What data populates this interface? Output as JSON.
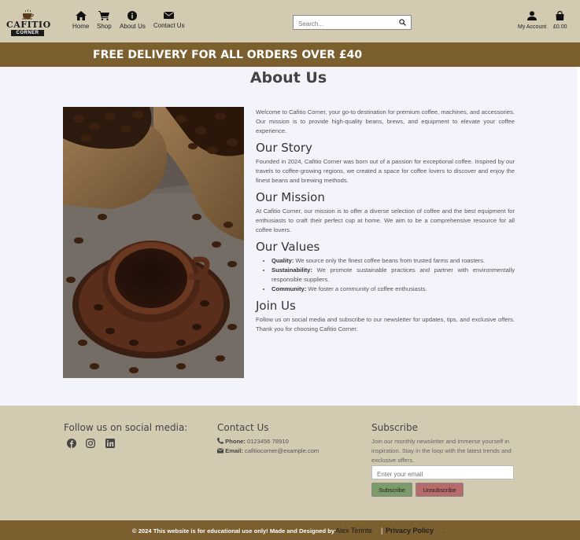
{
  "header": {
    "logo_text": "CAFITIO",
    "logo_sub": "CORNER",
    "nav": [
      {
        "label": "Home",
        "icon": "home-icon"
      },
      {
        "label": "Shop",
        "icon": "cart-icon"
      },
      {
        "label": "About Us",
        "icon": "info-icon"
      },
      {
        "label": "Contact Us",
        "icon": "envelope-icon"
      }
    ],
    "search_placeholder": "Search...",
    "account_label": "My Account",
    "cart_total": "£0.00"
  },
  "banner": {
    "text": "FREE DELIVERY FOR ALL ORDERS OVER £40"
  },
  "main": {
    "title": "About Us",
    "intro": "Welcome to Cafitio Corner, your go-to destination for premium coffee, machines, and accessories. Our mission is to provide high-quality beans, brews, and equipment to elevate your coffee experience.",
    "story_title": "Our Story",
    "story": "Founded in 2024, Cafitio Corner was born out of a passion for exceptional coffee. Inspired by our travels to coffee-growing regions, we created a space for coffee lovers to discover and enjoy the finest beans and brewing methods.",
    "mission_title": "Our Mission",
    "mission": "At Cafitio Corner, our mission is to offer a diverse selection of coffee and the best equipment for enthusiasts to craft their perfect cup at home. We aim to be a comprehensive resource for all coffee lovers.",
    "values_title": "Our Values",
    "values": [
      {
        "term": "Quality:",
        "text": " We source only the finest coffee beans from trusted farms and roasters."
      },
      {
        "term": "Sustainability:",
        "text": " We promote sustainable practices and partner with environmentally responsible suppliers."
      },
      {
        "term": "Community:",
        "text": " We foster a community of coffee enthusiasts."
      }
    ],
    "join_title": "Join Us",
    "join": "Follow us on social media and subscribe to our newsletter for updates, tips, and exclusive offers. Thank you for choosing Cafitio Corner."
  },
  "footer": {
    "social_title": "Follow us on social media:",
    "social_icons": [
      "facebook-icon",
      "instagram-icon",
      "linkedin-icon"
    ],
    "contact_title": "Contact Us",
    "phone_label": "Phone:",
    "phone": " 0123456 78910",
    "email_label": "Email:",
    "email": " cafitiocorner@example.com",
    "subscribe_title": "Subscribe",
    "subscribe_desc": "Join our monthly newsletter and immerse yourself in inspiration. Stay in the loop with the latest trends and exclusive offers.",
    "email_placeholder": "Enter your email",
    "subscribe_btn": "Subscribe",
    "unsubscribe_btn": "Unsubscribe"
  },
  "bottom": {
    "text": "© 2024 This website is for educational use only! Made and Designed by:",
    "author": "Alex Terinte",
    "separator": "|",
    "privacy": "Privacy Policy",
    "end": "."
  },
  "colors": {
    "header_bg": "#d3cab2",
    "banner_bg": "#7b5f2e",
    "subscribe": "#7c9b6a",
    "unsubscribe": "#b76b6b"
  }
}
